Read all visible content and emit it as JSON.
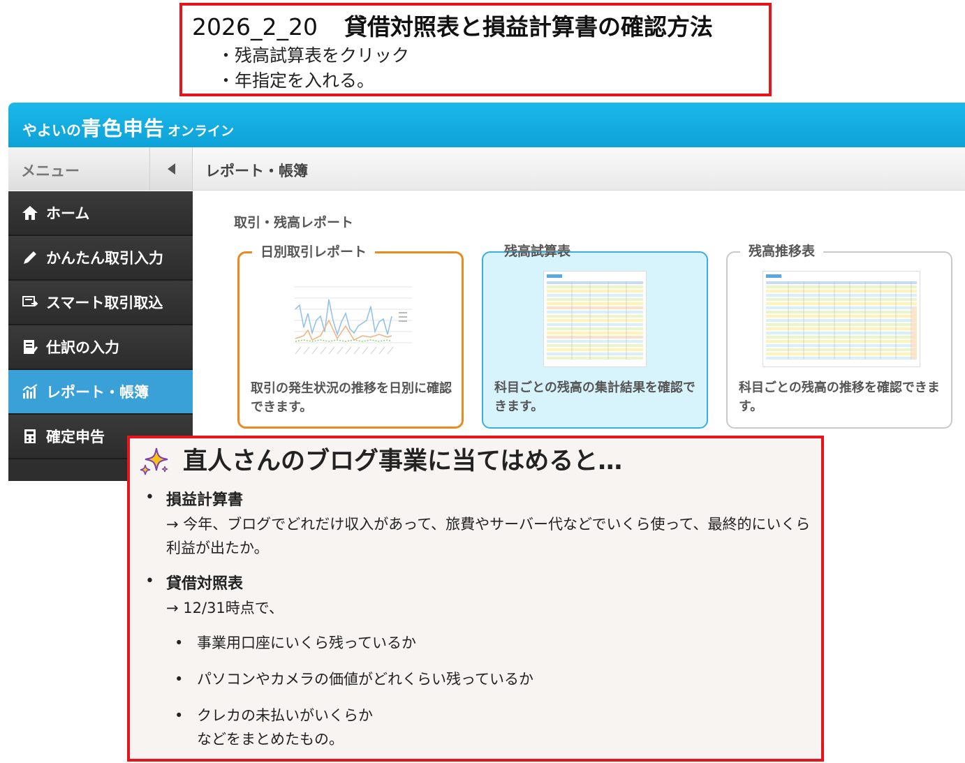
{
  "title_box": {
    "date": "2026_2_20",
    "title": "貸借対照表と損益計算書の確認方法",
    "steps": [
      "・残高試算表をクリック",
      "・年指定を入れる。"
    ]
  },
  "app": {
    "brand": {
      "part1": "やよいの",
      "part2": "青色申告",
      "part3": "オンライン"
    },
    "menu_label": "メニュー",
    "breadcrumb": "レポート・帳簿",
    "nav": [
      {
        "label": "ホーム",
        "icon": "home-icon"
      },
      {
        "label": "かんたん取引入力",
        "icon": "pencil-icon"
      },
      {
        "label": "スマート取引取込",
        "icon": "import-icon"
      },
      {
        "label": "仕訳の入力",
        "icon": "journal-icon"
      },
      {
        "label": "レポート・帳簿",
        "icon": "chart-icon",
        "active": true
      },
      {
        "label": "確定申告",
        "icon": "calculator-icon"
      }
    ],
    "section_title": "取引・残高レポート",
    "cards": [
      {
        "title": "日別取引レポート",
        "description": "取引の発生状況の推移を日別に確認できます。"
      },
      {
        "title": "残高試算表",
        "description": "科目ごとの残高の集計結果を確認できます。"
      },
      {
        "title": "残高推移表",
        "description": "科目ごとの残高の推移を確認できます。"
      }
    ],
    "colors": {
      "header": "#0ea2d8",
      "active_nav": "#3aa0d8",
      "card1_border": "#ec8a1e",
      "card2_border": "#3aaee0",
      "card2_bg": "#d7f3fc"
    }
  },
  "note_box": {
    "heading": "直人さんのブログ事業に当てはめると…",
    "heading_icon": "sparkles-icon",
    "bullet": "•",
    "items": [
      {
        "term": "損益計算書",
        "description": "→ 今年、ブログでどれだけ収入があって、旅費やサーバー代などでいくら使って、最終的にいくら利益が出たか。"
      },
      {
        "term": "貸借対照表",
        "description": "→ 12/31時点で、"
      }
    ],
    "subitems": [
      "事業用口座にいくら残っているか",
      "パソコンやカメラの価値がどれくらい残っているか",
      "クレカの未払いがいくらか"
    ],
    "closing": "などをまとめたもの。",
    "border_color": "#e8141b"
  }
}
